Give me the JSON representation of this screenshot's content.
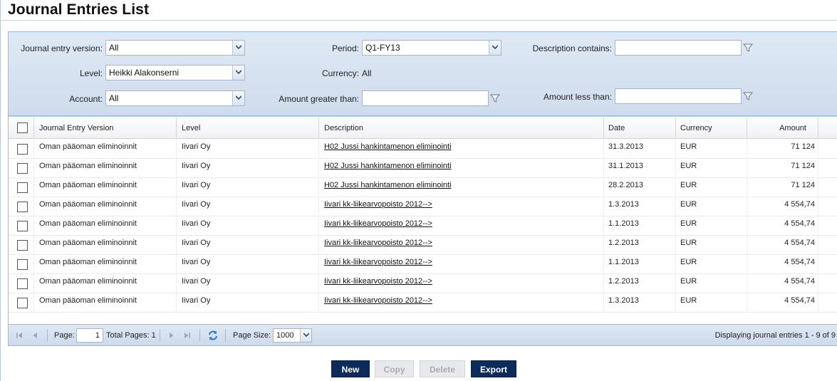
{
  "page": {
    "title": "Journal Entries List"
  },
  "filters": {
    "journal_entry_version": {
      "label": "Journal entry version:",
      "value": "All"
    },
    "period": {
      "label": "Period:",
      "value": "Q1-FY13"
    },
    "description_contains": {
      "label": "Description contains:",
      "value": ""
    },
    "level": {
      "label": "Level:",
      "value": "Heikki Alakonserni"
    },
    "currency": {
      "label": "Currency:",
      "value": "All"
    },
    "account": {
      "label": "Account:",
      "value": "All"
    },
    "amount_greater_than": {
      "label": "Amount greater than:",
      "value": ""
    },
    "amount_less_than": {
      "label": "Amount less than:",
      "value": ""
    }
  },
  "grid": {
    "columns": {
      "version": "Journal Entry Version",
      "level": "Level",
      "description": "Description",
      "date": "Date",
      "currency": "Currency",
      "amount": "Amount"
    },
    "rows": [
      {
        "version": "Oman pääoman eliminoinnit",
        "level": "Iivari Oy",
        "description": "H02 Jussi hankintamenon eliminointi",
        "date": "31.3.2013",
        "currency": "EUR",
        "amount": "71 124"
      },
      {
        "version": "Oman pääoman eliminoinnit",
        "level": "Iivari Oy",
        "description": "H02 Jussi hankintamenon eliminointi",
        "date": "31.1.2013",
        "currency": "EUR",
        "amount": "71 124"
      },
      {
        "version": "Oman pääoman eliminoinnit",
        "level": "Iivari Oy",
        "description": "H02 Jussi hankintamenon eliminointi",
        "date": "28.2.2013",
        "currency": "EUR",
        "amount": "71 124"
      },
      {
        "version": "Oman pääoman eliminoinnit",
        "level": "Iivari Oy",
        "description": "Iivari kk-liikearvopoisto 2012-->",
        "date": "1.3.2013",
        "currency": "EUR",
        "amount": "4 554,74"
      },
      {
        "version": "Oman pääoman eliminoinnit",
        "level": "Iivari Oy",
        "description": "Iivari kk-liikearvopoisto 2012-->",
        "date": "1.1.2013",
        "currency": "EUR",
        "amount": "4 554,74"
      },
      {
        "version": "Oman pääoman eliminoinnit",
        "level": "Iivari Oy",
        "description": "Iivari kk-liikearvopoisto 2012-->",
        "date": "1.2.2013",
        "currency": "EUR",
        "amount": "4 554,74"
      },
      {
        "version": "Oman pääoman eliminoinnit",
        "level": "Iivari Oy",
        "description": "Iivari kk-liikearvopoisto 2012-->",
        "date": "1.1.2013",
        "currency": "EUR",
        "amount": "4 554,74"
      },
      {
        "version": "Oman pääoman eliminoinnit",
        "level": "Iivari Oy",
        "description": "Iivari kk-liikearvopoisto 2012-->",
        "date": "1.2.2013",
        "currency": "EUR",
        "amount": "4 554,74"
      },
      {
        "version": "Oman pääoman eliminoinnit",
        "level": "Iivari Oy",
        "description": "Iivari kk-liikearvopoisto 2012-->",
        "date": "1.3.2013",
        "currency": "EUR",
        "amount": "4 554,74"
      }
    ]
  },
  "pager": {
    "page_label": "Page:",
    "page_value": "1",
    "total_pages_label": "Total Pages: 1",
    "page_size_label": "Page Size:",
    "page_size_value": "1000",
    "display_info": "Displaying journal entries 1 - 9 of 9"
  },
  "actions": {
    "new": "New",
    "copy": "Copy",
    "delete": "Delete",
    "export": "Export"
  },
  "icons": {
    "dropdown": "chevron-down-icon",
    "filter": "filter-icon",
    "first": "first-page-icon",
    "prev": "previous-page-icon",
    "next": "next-page-icon",
    "last": "last-page-icon",
    "refresh": "refresh-icon"
  },
  "colors": {
    "accent": "#0c2b5a",
    "panel": "#d7e3f1",
    "border": "#99bbe8"
  }
}
